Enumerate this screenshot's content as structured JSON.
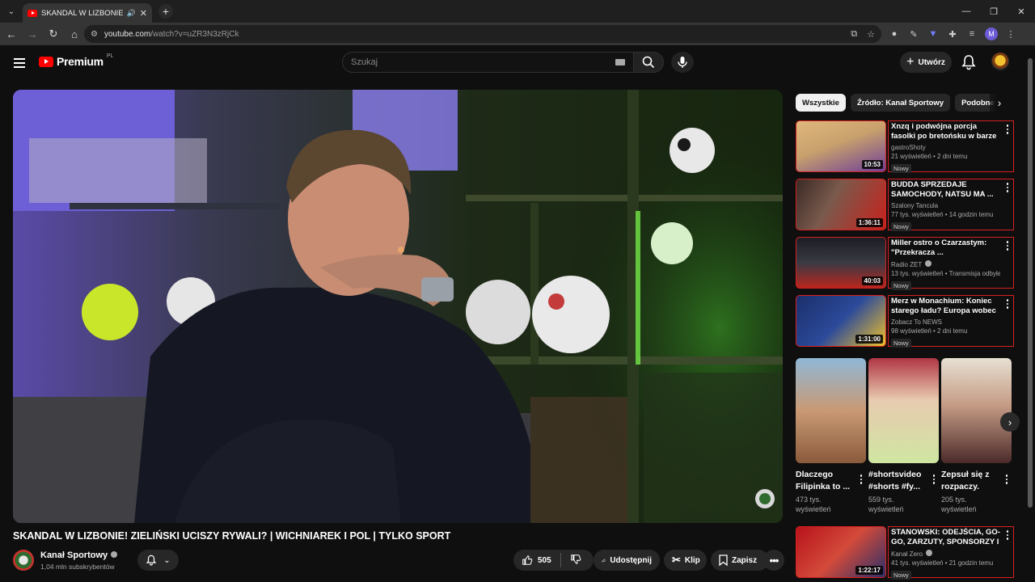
{
  "browser": {
    "tab_title": "SKANDAL W LIZBONIE! ZIELIŃSKI UCISZY RYWALI? | WICHNIAREK I POL | TYLKO SPORT",
    "url_host": "youtube.com",
    "url_path": "/watch?v=uZR3N3zRjCk",
    "profile_initial": "M"
  },
  "header": {
    "logo_text": "Premium",
    "country": "PL",
    "search_placeholder": "Szukaj",
    "create_label": "Utwórz"
  },
  "video": {
    "title": "SKANDAL W LIZBONIE! ZIELIŃSKI UCISZY RYWALI? | WICHNIAREK I POL | TYLKO SPORT",
    "channel_name": "Kanał Sportowy",
    "subscribers": "1,04 mln subskrybentów",
    "likes": "505",
    "share_label": "Udostępnij",
    "clip_label": "Klip",
    "save_label": "Zapisz"
  },
  "chips": [
    "Wszystkie",
    "Źródło: Kanał Sportowy",
    "Podobne"
  ],
  "recommendations": [
    {
      "title": "Xnzq i podwójna porcja fasolki po bretońsku w barze ...",
      "channel": "gastroShoty",
      "meta": "21 wyświetleń • 2 dni temu",
      "badge": "Nowy",
      "duration": "10:53",
      "color_a": "#e0b77c",
      "color_b": "#6f3f97"
    },
    {
      "title": "BUDDA SPRZEDAJE SAMOCHODY, NATSU MA ...",
      "channel": "Szalony Tancula",
      "meta": "77 tys. wyświetleń • 14 godzin temu",
      "badge": "Nowy",
      "duration": "1:36:11",
      "color_a": "#3a2a26",
      "color_b": "#c8221d"
    },
    {
      "title": "Miller ostro o Czarzastym: \"Przekracza ...",
      "channel": "Radio ZET",
      "meta": "13 tys. wyświetleń • Transmisja odbyła s...",
      "badge": "Nowy",
      "duration": "40:03",
      "color_a": "#1d1d24",
      "color_b": "#b9261e"
    },
    {
      "title": "Merz w Monachium: Koniec starego ładu? Europa wobec ...",
      "channel": "Zobacz To NEWS",
      "meta": "98 wyświetleń • 2 dni temu",
      "badge": "Nowy",
      "duration": "1:31:00",
      "color_a": "#1b2f6b",
      "color_b": "#f0c22a"
    },
    {
      "title": "STANOWSKI: ODEJŚCIA, GO-GO, ZARZUTY, SPONSORZY I ...",
      "channel": "Kanał Zero",
      "meta": "41 tys. wyświetleń • 21 godzin temu",
      "badge": "Nowy",
      "duration": "1:22:17",
      "color_a": "#b8131b",
      "color_b": "#2a2f6a"
    }
  ],
  "shorts": [
    {
      "title": "Dlaczego Filipinka to ...",
      "views": "473 tys. wyświetleń",
      "color_a": "#8fb7d6",
      "color_b": "#8a5a3c"
    },
    {
      "title": "#shortsvideo #shorts #fy...",
      "views": "559 tys. wyświetleń",
      "color_a": "#cfe6a1",
      "color_b": "#b03645"
    },
    {
      "title": "Zepsuł się z rozpaczy.",
      "views": "205 tys. wyświetleń",
      "color_a": "#e7e0d2",
      "color_b": "#4b2a2a"
    }
  ]
}
